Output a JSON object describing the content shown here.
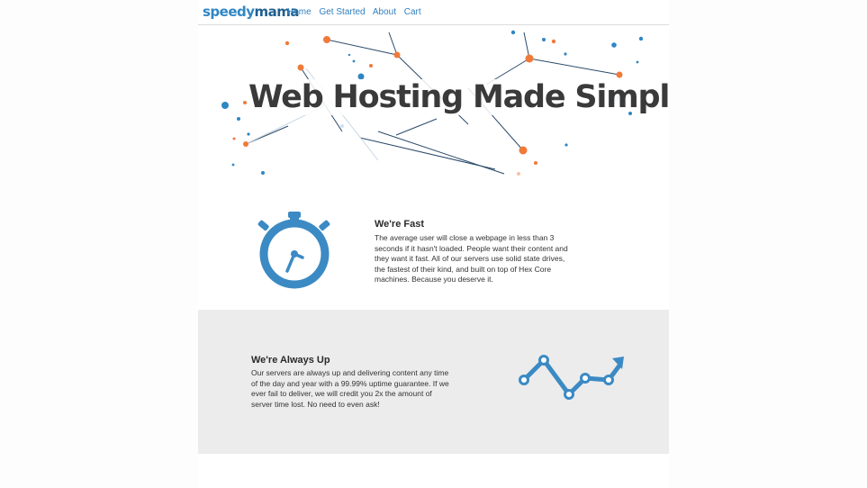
{
  "brand": {
    "part1": "speedy",
    "part2": "mama",
    "color1": "#2f86c4",
    "color2": "#1f5f8f"
  },
  "nav": {
    "links": [
      "Home",
      "Get Started",
      "About",
      "Cart"
    ]
  },
  "hero": {
    "title": "Web Hosting Made Simple"
  },
  "features": [
    {
      "title": "We're Fast",
      "body": "The average user will close a webpage in less than 3 seconds if it hasn't loaded. People want their content and they want it fast. All of our servers use solid state drives, the fastest of their kind, and built on top of Hex Core machines. Because you deserve it.",
      "icon": "stopwatch-icon"
    },
    {
      "title": "We're Always Up",
      "body": "Our servers are always up and delivering content any time of the day and year with a 99.99% uptime guarantee. If we ever fail to deliver, we will credit you 2x the amount of server time lost. No need to even ask!",
      "icon": "trend-up-icon"
    }
  ],
  "colors": {
    "accent": "#3b8ac4",
    "orange": "#f07a3a",
    "dark_line": "#2a4a6a",
    "gray_band": "#ececec"
  }
}
